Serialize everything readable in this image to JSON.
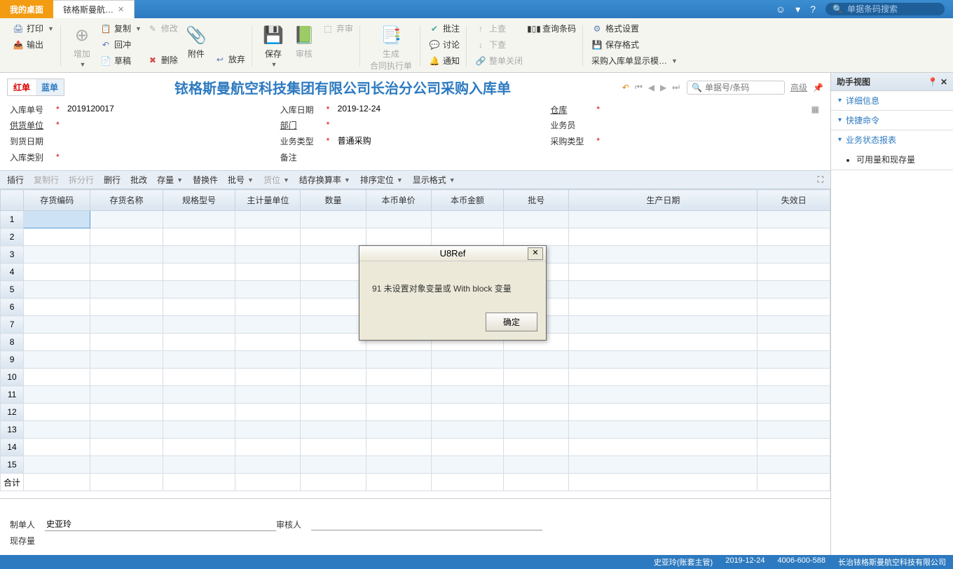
{
  "topTabs": {
    "desktop": "我的桌面",
    "doc": "铱格斯曼航…"
  },
  "topSearch": {
    "placeholder": "单据条码搜索"
  },
  "ribbon": {
    "print": "打印",
    "export": "输出",
    "add": "增加",
    "copy": "复制",
    "undoRed": "回冲",
    "draft": "草稿",
    "edit": "修改",
    "delete": "删除",
    "attach": "附件",
    "abandon": "放弃",
    "save": "保存",
    "audit": "审核",
    "discard": "弃审",
    "genContract": "生成\n合同执行单",
    "approve": "批注",
    "discuss": "讨论",
    "notify": "通知",
    "checkUp": "上查",
    "checkDown": "下查",
    "linkClose": "整单关闭",
    "queryBarcode": "查询条码",
    "formatSet": "格式设置",
    "saveFormat": "保存格式",
    "displayTpl": "采购入库单显示模…"
  },
  "redBlue": {
    "red": "红单",
    "blue": "蓝单"
  },
  "docTitle": "铱格斯曼航空科技集团有限公司长治分公司采购入库单",
  "docNav": {
    "searchPlaceholder": "单据号/条码",
    "advanced": "高级"
  },
  "form": {
    "receiptNo": {
      "label": "入库单号",
      "value": "2019120017"
    },
    "receiptDate": {
      "label": "入库日期",
      "value": "2019-12-24"
    },
    "warehouse": {
      "label": "仓库",
      "value": ""
    },
    "supplier": {
      "label": "供货单位",
      "value": ""
    },
    "dept": {
      "label": "部门",
      "value": ""
    },
    "operator": {
      "label": "业务员",
      "value": ""
    },
    "arrivalDate": {
      "label": "到货日期",
      "value": ""
    },
    "bizType": {
      "label": "业务类型",
      "value": "普通采购"
    },
    "purchType": {
      "label": "采购类型",
      "value": ""
    },
    "receiptCat": {
      "label": "入库类别",
      "value": ""
    },
    "remark": {
      "label": "备注",
      "value": ""
    }
  },
  "gridToolbar": {
    "insertRow": "插行",
    "copyRow": "复制行",
    "splitRow": "拆分行",
    "delRow": "删行",
    "batchMod": "批改",
    "stock": "存量",
    "replace": "替换件",
    "batch": "批号",
    "location": "货位",
    "settle": "结存换算率",
    "sort": "排序定位",
    "dispFmt": "显示格式"
  },
  "gridCols": {
    "code": "存货编码",
    "name": "存货名称",
    "spec": "规格型号",
    "unit": "主计量单位",
    "qty": "数量",
    "price": "本币单价",
    "amount": "本币金额",
    "batch": "批号",
    "prodDate": "生产日期",
    "expDate": "失效日"
  },
  "gridRows": 15,
  "sumLabel": "合计",
  "footer": {
    "maker": {
      "label": "制单人",
      "value": "史亚玲"
    },
    "auditor": {
      "label": "审核人",
      "value": ""
    },
    "curStock": {
      "label": "现存量",
      "value": ""
    }
  },
  "rightPanel": {
    "title": "助手视图",
    "sections": {
      "detail": "详细信息",
      "quick": "快捷命令",
      "report": "业务状态报表"
    },
    "items": {
      "availStock": "可用量和现存量"
    }
  },
  "modal": {
    "title": "U8Ref",
    "message": "91 未设置对象变量或 With block 变量",
    "ok": "确定"
  },
  "statusBar": {
    "user": "史亚玲(账套主管)",
    "date": "2019-12-24",
    "ver": "4006-600-588",
    "company": "长治铱格斯曼航空科技有限公司"
  }
}
